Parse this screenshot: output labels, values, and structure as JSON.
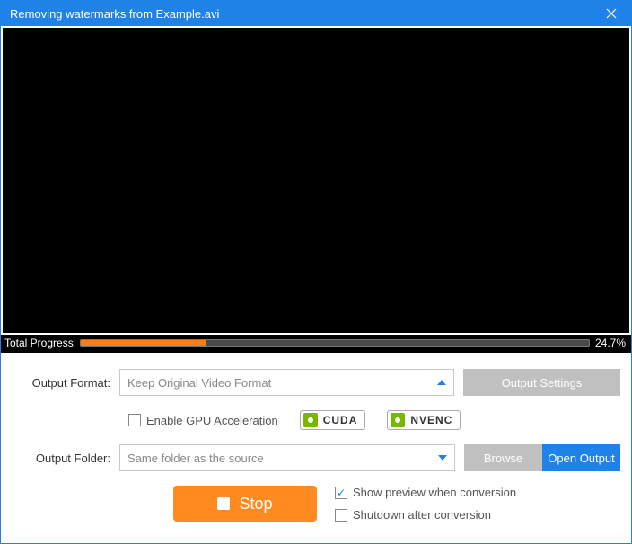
{
  "window": {
    "title": "Removing watermarks from Example.avi"
  },
  "progress": {
    "label": "Total Progress:",
    "percent_text": "24.7%",
    "percent_value": 24.7
  },
  "format": {
    "label": "Output Format:",
    "selected": "Keep Original Video Format",
    "settings_button": "Output Settings"
  },
  "gpu": {
    "checkbox_label": "Enable GPU Acceleration",
    "badge_cuda": "CUDA",
    "badge_nvenc": "NVENC"
  },
  "folder": {
    "label": "Output Folder:",
    "selected": "Same folder as the source",
    "browse": "Browse",
    "open": "Open Output"
  },
  "actions": {
    "stop": "Stop",
    "show_preview": "Show preview when conversion",
    "shutdown": "Shutdown after conversion"
  }
}
